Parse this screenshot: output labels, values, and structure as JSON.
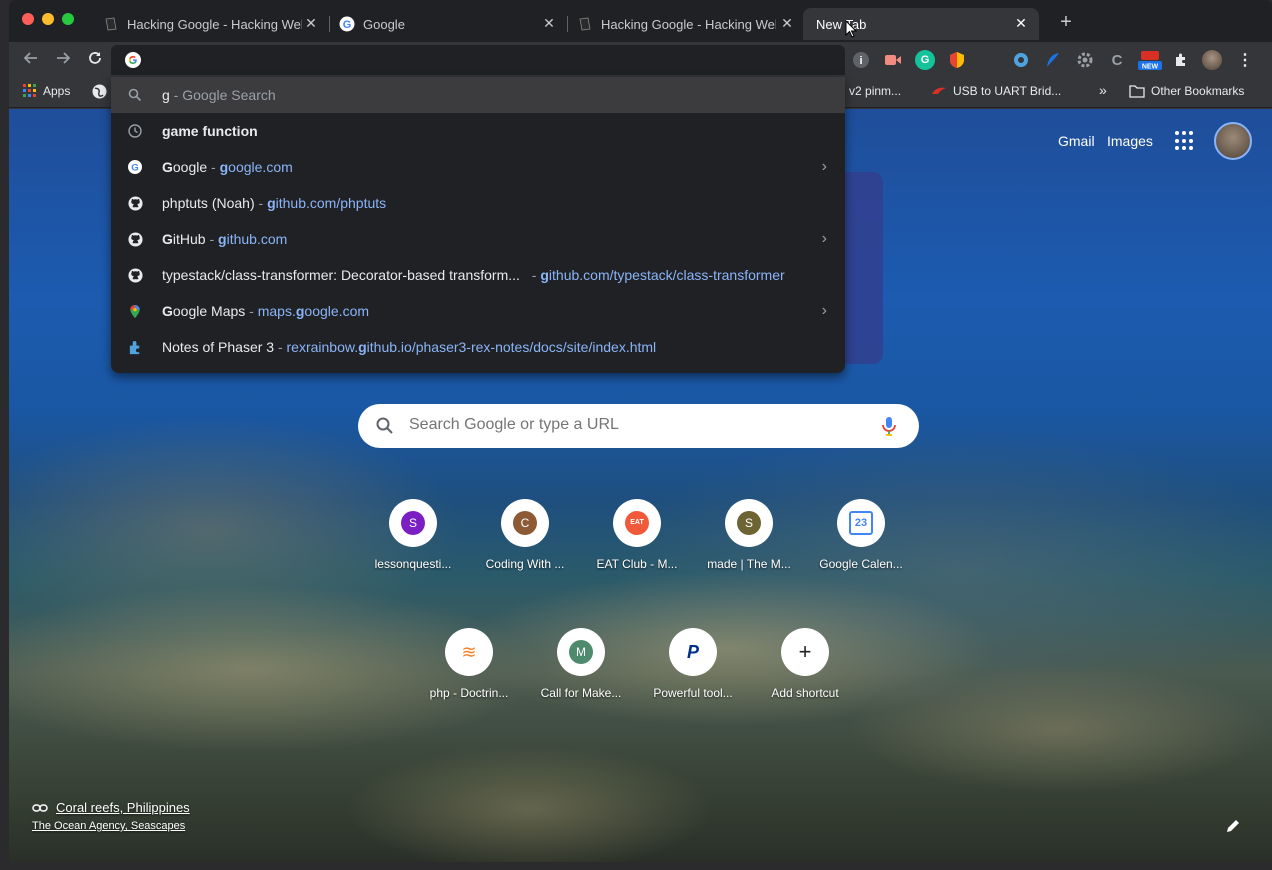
{
  "tabs": [
    {
      "title": "Hacking Google - Hacking Web",
      "icon": "document-icon",
      "active": false
    },
    {
      "title": "Google",
      "icon": "google-g-icon",
      "active": false
    },
    {
      "title": "Hacking Google - Hacking Web",
      "icon": "document-icon",
      "active": false
    },
    {
      "title": "New Tab",
      "icon": "none",
      "active": true
    }
  ],
  "omnibox": {
    "value": ""
  },
  "bookmarks": {
    "apps": "Apps",
    "item_pinmux": "u v2 pinm...",
    "item_uart": "USB to UART Brid...",
    "overflow": "»",
    "other": "Other Bookmarks"
  },
  "suggestions": [
    {
      "icon": "search-icon",
      "bold": "g",
      "sep": " - ",
      "rest": "Google Search",
      "url_bold": "",
      "url_rest": "",
      "arrow": false,
      "selected": true
    },
    {
      "icon": "history-icon",
      "bold": "game function",
      "sep": "",
      "rest": "",
      "url_bold": "",
      "url_rest": "",
      "arrow": false,
      "selected": false
    },
    {
      "icon": "google-g-icon",
      "bold": "G",
      "rest_main": "oogle",
      "sep": " - ",
      "url_bold": "g",
      "url_rest": "oogle.com",
      "arrow": true
    },
    {
      "icon": "github-icon",
      "main": "phptuts (Noah)",
      "sep": " - ",
      "url_bold": "g",
      "url_rest": "ithub.com/phptuts",
      "arrow": false
    },
    {
      "icon": "github-icon",
      "bold": "G",
      "rest_main": "itHub",
      "sep": " - ",
      "url_bold": "g",
      "url_rest": "ithub.com",
      "arrow": true
    },
    {
      "icon": "github-icon",
      "main": "typestack/class-transformer: Decorator-based transform...",
      "sep": " - ",
      "url_bold": "g",
      "url_rest": "ithub.com/typestack/class-transformer",
      "arrow": false
    },
    {
      "icon": "maps-pin-icon",
      "bold": "G",
      "rest_main": "oogle Maps",
      "sep": " - ",
      "url_pre": "maps.",
      "url_bold": "g",
      "url_rest": "oogle.com",
      "arrow": true
    },
    {
      "icon": "puzzle-icon",
      "main": "Notes of Phaser 3",
      "sep": " - ",
      "url_pre": "rexrainbow.",
      "url_bold": "g",
      "url_rest": "ithub.io/phaser3-rex-notes/docs/site/index.html",
      "arrow": false
    }
  ],
  "header": {
    "gmail": "Gmail",
    "images": "Images"
  },
  "search": {
    "placeholder": "Search Google or type a URL"
  },
  "shortcuts": [
    {
      "label": "lessonquesti...",
      "letter": "S",
      "color": "#7b1fc2"
    },
    {
      "label": "Coding With ...",
      "letter": "C",
      "color": "#8d5a36"
    },
    {
      "label": "EAT Club - M...",
      "letter": "EAT",
      "color": "#f05a3a"
    },
    {
      "label": "made | The M...",
      "letter": "S",
      "color": "#6d6434"
    },
    {
      "label": "Google Calen...",
      "letter": "23",
      "color": "#4285f4"
    },
    {
      "label": "php - Doctrin...",
      "letter": "≋",
      "color": "#f48024"
    },
    {
      "label": "Call for Make...",
      "letter": "M",
      "color": "#4e8a6e"
    },
    {
      "label": "Powerful tool...",
      "letter": "P",
      "color": "#003087"
    },
    {
      "label": "Add shortcut",
      "letter": "+",
      "color": "#202124"
    }
  ],
  "attribution": {
    "title": "Coral reefs, Philippines",
    "credit": "The Ocean Agency, Seascapes"
  }
}
